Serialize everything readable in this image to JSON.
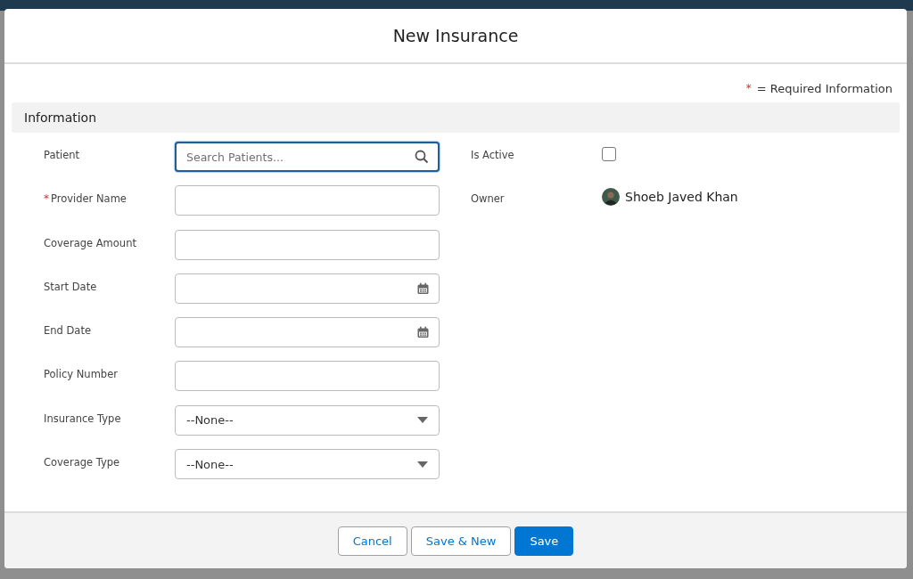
{
  "modal": {
    "title": "New Insurance"
  },
  "required_legend": {
    "mark": "*",
    "text": "= Required Information"
  },
  "section": {
    "title": "Information"
  },
  "left_fields": [
    {
      "label": "Patient",
      "kind": "lookup",
      "required": false,
      "focused": true,
      "placeholder": "Search Patients..."
    },
    {
      "label": "Provider Name",
      "kind": "text",
      "required": true,
      "focused": false
    },
    {
      "label": "Coverage Amount",
      "kind": "text",
      "required": false,
      "focused": false
    },
    {
      "label": "Start Date",
      "kind": "date",
      "required": false,
      "focused": false
    },
    {
      "label": "End Date",
      "kind": "date",
      "required": false,
      "focused": false
    },
    {
      "label": "Policy Number",
      "kind": "text",
      "required": false,
      "focused": false
    },
    {
      "label": "Insurance Type",
      "kind": "picklist",
      "required": false,
      "focused": false,
      "value": "--None--"
    },
    {
      "label": "Coverage Type",
      "kind": "picklist",
      "required": false,
      "focused": false,
      "value": "--None--"
    }
  ],
  "right_fields": [
    {
      "label": "Is Active",
      "kind": "checkbox",
      "checked": false
    },
    {
      "label": "Owner",
      "kind": "user",
      "value": "Shoeb Javed Khan"
    }
  ],
  "buttons": [
    {
      "label": "Cancel",
      "kind": "neutral"
    },
    {
      "label": "Save & New",
      "kind": "neutral"
    },
    {
      "label": "Save",
      "kind": "brand"
    }
  ]
}
